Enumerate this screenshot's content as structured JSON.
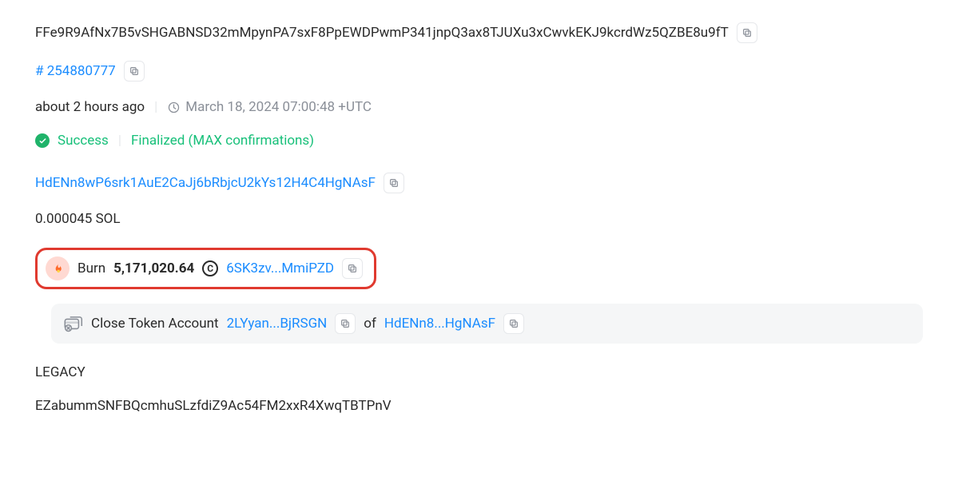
{
  "tx": {
    "signature": "FFe9R9AfNx7B5vSHGABNSD32mMpynPA7sxF8PpEWDPwmP341jnpQ3ax8TJUXu3xCwvkEKJ9kcrdWz5QZBE8u9fT",
    "slot_prefix": "# ",
    "slot": "254880777",
    "age": "about 2 hours ago",
    "timestamp": "March 18, 2024 07:00:48 +UTC",
    "status": "Success",
    "confirmations": "Finalized (MAX confirmations)",
    "fee_payer": "HdENn8wP6srk1AuE2CaJj6bRbjcU2kYs12H4C4HgNAsF",
    "fee": "0.000045 SOL",
    "version": "LEGACY",
    "alt": "EZabummSNFBQcmhuSLzfdiZ9Ac54FM2xxR4XwqTBTPnV"
  },
  "burn": {
    "label": "Burn",
    "amount": "5,171,020.64",
    "coin_symbol": "C",
    "token_link": "6SK3zv...MmiPZD"
  },
  "close": {
    "label": "Close Token Account",
    "account_link": "2LYyan...BjRSGN",
    "of": "of",
    "owner_link": "HdENn8...HgNAsF"
  }
}
